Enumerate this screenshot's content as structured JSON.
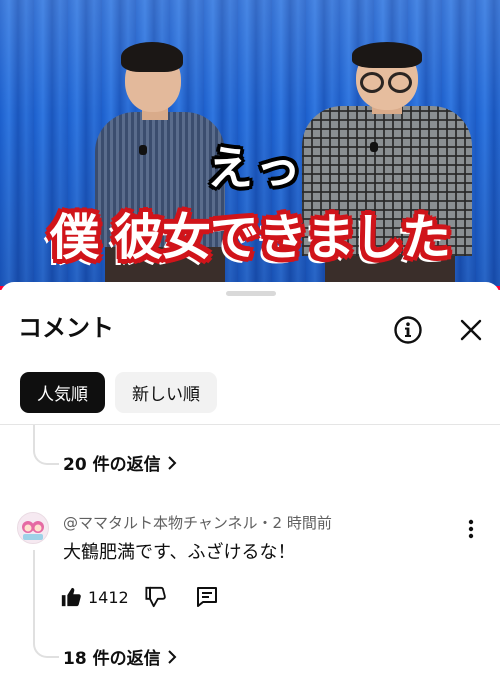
{
  "video": {
    "caption_line1": "えっ",
    "caption_line2": "僕 彼女できました",
    "progress_percent": 100
  },
  "comments_panel": {
    "title": "コメント",
    "info_icon": "info-icon",
    "close_icon": "close-icon",
    "sort_chips": [
      {
        "label": "人気順",
        "selected": true
      },
      {
        "label": "新しい順",
        "selected": false
      }
    ],
    "threads": [
      {
        "replies_label": "20 件の返信",
        "chevron": "›"
      },
      {
        "author": "@ママタルト本物チャンネル・2 時間前",
        "text": "大鶴肥満です、ふざけるな！",
        "likes": "1412",
        "replies_label": "18 件の返信",
        "chevron": "›"
      }
    ]
  },
  "colors": {
    "accent_red": "#ff0033",
    "caption_outline": "#d0141a",
    "chip_active_bg": "#0f0f0f",
    "chip_inactive_bg": "#f2f2f2"
  }
}
